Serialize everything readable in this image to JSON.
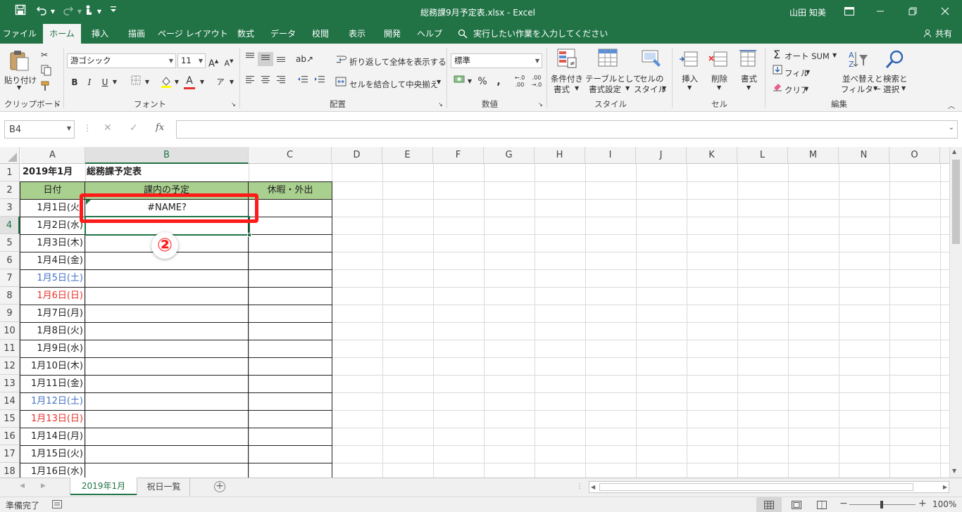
{
  "title_bar": {
    "file_title": "総務課9月予定表.xlsx  -  Excel",
    "user": "山田 知美",
    "qat": {
      "save_icon": "save-icon",
      "undo_icon": "undo-icon",
      "redo_icon": "redo-icon",
      "touch_icon": "touch-mode-icon",
      "customize_icon": "customize-icon"
    }
  },
  "ribbon_tabs": [
    "ファイル",
    "ホーム",
    "挿入",
    "描画",
    "ページ レイアウト",
    "数式",
    "データ",
    "校閲",
    "表示",
    "開発",
    "ヘルプ"
  ],
  "active_tab": "ホーム",
  "tell_me": "実行したい作業を入力してください",
  "share": "共有",
  "ribbon": {
    "clipboard": {
      "group": "クリップボード",
      "paste": "貼り付け"
    },
    "font": {
      "group": "フォント",
      "font_name": "游ゴシック",
      "font_size": "11",
      "bold": "B",
      "italic": "I",
      "underline": "U",
      "grow": "A",
      "shrink": "A",
      "font_color_letter": "A"
    },
    "alignment": {
      "group": "配置",
      "wrap": "折り返して全体を表示する",
      "merge": "セルを結合して中央揃え"
    },
    "number": {
      "group": "数値",
      "format": "標準"
    },
    "styles": {
      "group": "スタイル",
      "conditional_1": "条件付き",
      "conditional_2": "書式",
      "table_1": "テーブルとして",
      "table_2": "書式設定",
      "cellstyle_1": "セルの",
      "cellstyle_2": "スタイル"
    },
    "cells": {
      "group": "セル",
      "insert": "挿入",
      "delete": "削除",
      "format": "書式"
    },
    "editing": {
      "group": "編集",
      "autosum": "オート SUM",
      "fill": "フィル",
      "clear": "クリア",
      "sort_1": "並べ替えと",
      "sort_2": "フィルター",
      "find_1": "検索と",
      "find_2": "選択"
    }
  },
  "formula_bar": {
    "name_box": "B4",
    "formula": "",
    "fx": "fx"
  },
  "columns": [
    "A",
    "B",
    "C",
    "D",
    "E",
    "F",
    "G",
    "H",
    "I",
    "J",
    "K",
    "L",
    "M",
    "N",
    "O"
  ],
  "rows": [
    "1",
    "2",
    "3",
    "4",
    "5",
    "6",
    "7",
    "8",
    "9",
    "10",
    "11",
    "12",
    "13",
    "14",
    "15",
    "16",
    "17",
    "18"
  ],
  "sheet": {
    "a1": "2019年1月",
    "b1": "総務課予定表",
    "headers": {
      "a": "日付",
      "b": "課内の予定",
      "c": "休暇・外出"
    },
    "b3": "#NAME?",
    "dates": [
      {
        "text": "1月1日(火)",
        "color": "#222222"
      },
      {
        "text": "1月2日(水)",
        "color": "#222222"
      },
      {
        "text": "1月3日(木)",
        "color": "#222222"
      },
      {
        "text": "1月4日(金)",
        "color": "#222222"
      },
      {
        "text": "1月5日(土)",
        "color": "#4472c4"
      },
      {
        "text": "1月6日(日)",
        "color": "#e8312a"
      },
      {
        "text": "1月7日(月)",
        "color": "#222222"
      },
      {
        "text": "1月8日(火)",
        "color": "#222222"
      },
      {
        "text": "1月9日(水)",
        "color": "#222222"
      },
      {
        "text": "1月10日(木)",
        "color": "#222222"
      },
      {
        "text": "1月11日(金)",
        "color": "#222222"
      },
      {
        "text": "1月12日(土)",
        "color": "#4472c4"
      },
      {
        "text": "1月13日(日)",
        "color": "#e8312a"
      },
      {
        "text": "1月14日(月)",
        "color": "#222222"
      },
      {
        "text": "1月15日(火)",
        "color": "#222222"
      },
      {
        "text": "1月16日(水)",
        "color": "#222222"
      }
    ],
    "header_fill": "#a9d08e"
  },
  "annotation": {
    "step": "②",
    "color": "#ff1a1a"
  },
  "sheet_tabs": [
    "2019年1月",
    "祝日一覧"
  ],
  "active_sheet": "2019年1月",
  "status": {
    "ready": "準備完了",
    "zoom": "100%"
  },
  "colors": {
    "excel_green": "#217346",
    "selection": "#217346"
  }
}
